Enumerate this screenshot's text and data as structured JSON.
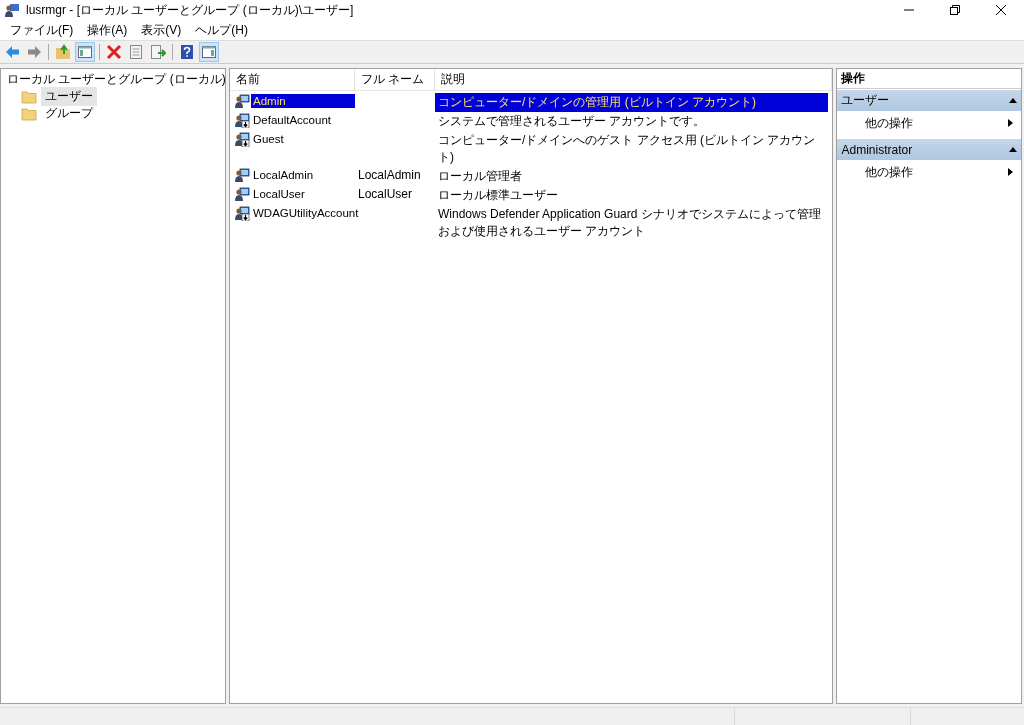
{
  "window": {
    "title": "lusrmgr - [ローカル ユーザーとグループ (ローカル)\\ユーザー]"
  },
  "menu": [
    "ファイル(F)",
    "操作(A)",
    "表示(V)",
    "ヘルプ(H)"
  ],
  "toolbar": [
    {
      "kind": "back",
      "pressed": false
    },
    {
      "kind": "forward",
      "pressed": false
    },
    {
      "kind": "sep"
    },
    {
      "kind": "up",
      "pressed": false
    },
    {
      "kind": "tree",
      "pressed": true
    },
    {
      "kind": "sep"
    },
    {
      "kind": "delete",
      "pressed": false
    },
    {
      "kind": "properties",
      "pressed": false
    },
    {
      "kind": "export",
      "pressed": false
    },
    {
      "kind": "sep"
    },
    {
      "kind": "help",
      "pressed": false
    },
    {
      "kind": "pane",
      "pressed": true
    }
  ],
  "tree": {
    "label": "ローカル ユーザーとグループ (ローカル)",
    "children": [
      {
        "label": "ユーザー",
        "selected": true
      },
      {
        "label": "グループ",
        "selected": false
      }
    ]
  },
  "table": {
    "columns": [
      "名前",
      "フル ネーム",
      "説明"
    ],
    "rows": [
      {
        "name": "Admin",
        "full_name": "",
        "description": "コンピューター/ドメインの管理用 (ビルトイン アカウント)",
        "selected": true,
        "disabled": false
      },
      {
        "name": "DefaultAccount",
        "full_name": "",
        "description": "システムで管理されるユーザー アカウントです。",
        "selected": false,
        "disabled": true
      },
      {
        "name": "Guest",
        "full_name": "",
        "description": "コンピューター/ドメインへのゲスト アクセス用 (ビルトイン アカウント)",
        "selected": false,
        "disabled": true
      },
      {
        "name": "LocalAdmin",
        "full_name": "LocalAdmin",
        "description": "ローカル管理者",
        "selected": false,
        "disabled": false
      },
      {
        "name": "LocalUser",
        "full_name": "LocalUser",
        "description": "ローカル標準ユーザー",
        "selected": false,
        "disabled": false
      },
      {
        "name": "WDAGUtilityAccount",
        "full_name": "",
        "description": "Windows Defender Application Guard シナリオでシステムによって管理および使用されるユーザー アカウント",
        "selected": false,
        "disabled": true
      }
    ]
  },
  "actions": {
    "title": "操作",
    "sections": [
      {
        "header": "ユーザー",
        "expanded": true,
        "items": [
          "他の操作"
        ]
      },
      {
        "header": "Administrator",
        "expanded": true,
        "items": [
          "他の操作"
        ]
      }
    ]
  }
}
